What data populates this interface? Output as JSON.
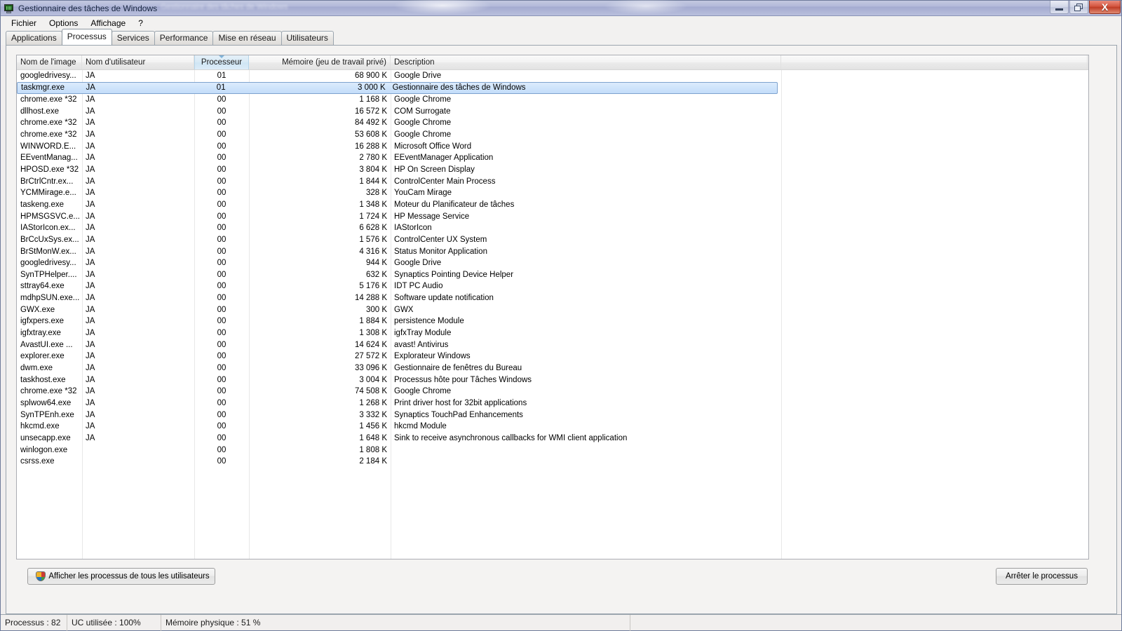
{
  "window": {
    "title": "Gestionnaire des tâches de Windows",
    "title_ghost": "Gestionnaire des tâches de Windows",
    "icon": "task-manager-icon",
    "buttons": {
      "minimize": "minimize-icon",
      "maximize": "restore-icon",
      "close": "X"
    }
  },
  "menu": {
    "items": [
      {
        "label": "Fichier"
      },
      {
        "label": "Options"
      },
      {
        "label": "Affichage"
      },
      {
        "label": "?"
      }
    ]
  },
  "tabs": [
    {
      "label": "Applications",
      "active": false
    },
    {
      "label": "Processus",
      "active": true
    },
    {
      "label": "Services",
      "active": false
    },
    {
      "label": "Performance",
      "active": false
    },
    {
      "label": "Mise en réseau",
      "active": false
    },
    {
      "label": "Utilisateurs",
      "active": false
    }
  ],
  "table": {
    "sort_column": "Processeur",
    "sort_direction": "descending",
    "columns": [
      {
        "key": "name",
        "label": "Nom de l'image",
        "align": "left"
      },
      {
        "key": "user",
        "label": "Nom d'utilisateur",
        "align": "left"
      },
      {
        "key": "cpu",
        "label": "Processeur",
        "align": "center"
      },
      {
        "key": "mem",
        "label": "Mémoire (jeu de travail privé)",
        "align": "right"
      },
      {
        "key": "desc",
        "label": "Description",
        "align": "left"
      }
    ],
    "rows": [
      {
        "name": "googledrivesy...",
        "user": "JA",
        "cpu": "01",
        "mem": "68 900 K",
        "desc": "Google Drive",
        "selected": false
      },
      {
        "name": "taskmgr.exe",
        "user": "JA",
        "cpu": "01",
        "mem": "3 000 K",
        "desc": "Gestionnaire des tâches de Windows",
        "selected": true
      },
      {
        "name": "chrome.exe *32",
        "user": "JA",
        "cpu": "00",
        "mem": "1 168 K",
        "desc": "Google Chrome",
        "selected": false
      },
      {
        "name": "dllhost.exe",
        "user": "JA",
        "cpu": "00",
        "mem": "16 572 K",
        "desc": "COM Surrogate",
        "selected": false
      },
      {
        "name": "chrome.exe *32",
        "user": "JA",
        "cpu": "00",
        "mem": "84 492 K",
        "desc": "Google Chrome",
        "selected": false
      },
      {
        "name": "chrome.exe *32",
        "user": "JA",
        "cpu": "00",
        "mem": "53 608 K",
        "desc": "Google Chrome",
        "selected": false
      },
      {
        "name": "WINWORD.E...",
        "user": "JA",
        "cpu": "00",
        "mem": "16 288 K",
        "desc": "Microsoft Office Word",
        "selected": false
      },
      {
        "name": "EEventManag...",
        "user": "JA",
        "cpu": "00",
        "mem": "2 780 K",
        "desc": "EEventManager Application",
        "selected": false
      },
      {
        "name": "HPOSD.exe *32",
        "user": "JA",
        "cpu": "00",
        "mem": "3 804 K",
        "desc": "HP On Screen Display",
        "selected": false
      },
      {
        "name": "BrCtrlCntr.ex...",
        "user": "JA",
        "cpu": "00",
        "mem": "1 844 K",
        "desc": "ControlCenter Main Process",
        "selected": false
      },
      {
        "name": "YCMMirage.e...",
        "user": "JA",
        "cpu": "00",
        "mem": "328 K",
        "desc": "YouCam Mirage",
        "selected": false
      },
      {
        "name": "taskeng.exe",
        "user": "JA",
        "cpu": "00",
        "mem": "1 348 K",
        "desc": "Moteur du Planificateur de tâches",
        "selected": false
      },
      {
        "name": "HPMSGSVC.e...",
        "user": "JA",
        "cpu": "00",
        "mem": "1 724 K",
        "desc": "HP Message Service",
        "selected": false
      },
      {
        "name": "IAStorIcon.ex...",
        "user": "JA",
        "cpu": "00",
        "mem": "6 628 K",
        "desc": "IAStorIcon",
        "selected": false
      },
      {
        "name": "BrCcUxSys.ex...",
        "user": "JA",
        "cpu": "00",
        "mem": "1 576 K",
        "desc": "ControlCenter UX System",
        "selected": false
      },
      {
        "name": "BrStMonW.ex...",
        "user": "JA",
        "cpu": "00",
        "mem": "4 316 K",
        "desc": "Status Monitor Application",
        "selected": false
      },
      {
        "name": "googledrivesy...",
        "user": "JA",
        "cpu": "00",
        "mem": "944 K",
        "desc": "Google Drive",
        "selected": false
      },
      {
        "name": "SynTPHelper....",
        "user": "JA",
        "cpu": "00",
        "mem": "632 K",
        "desc": "Synaptics Pointing Device Helper",
        "selected": false
      },
      {
        "name": "sttray64.exe",
        "user": "JA",
        "cpu": "00",
        "mem": "5 176 K",
        "desc": "IDT PC Audio",
        "selected": false
      },
      {
        "name": "mdhpSUN.exe...",
        "user": "JA",
        "cpu": "00",
        "mem": "14 288 K",
        "desc": "Software update notification",
        "selected": false
      },
      {
        "name": "GWX.exe",
        "user": "JA",
        "cpu": "00",
        "mem": "300 K",
        "desc": "GWX",
        "selected": false
      },
      {
        "name": "igfxpers.exe",
        "user": "JA",
        "cpu": "00",
        "mem": "1 884 K",
        "desc": "persistence Module",
        "selected": false
      },
      {
        "name": "igfxtray.exe",
        "user": "JA",
        "cpu": "00",
        "mem": "1 308 K",
        "desc": "igfxTray Module",
        "selected": false
      },
      {
        "name": "AvastUI.exe ...",
        "user": "JA",
        "cpu": "00",
        "mem": "14 624 K",
        "desc": "avast! Antivirus",
        "selected": false
      },
      {
        "name": "explorer.exe",
        "user": "JA",
        "cpu": "00",
        "mem": "27 572 K",
        "desc": "Explorateur Windows",
        "selected": false
      },
      {
        "name": "dwm.exe",
        "user": "JA",
        "cpu": "00",
        "mem": "33 096 K",
        "desc": "Gestionnaire de fenêtres du Bureau",
        "selected": false
      },
      {
        "name": "taskhost.exe",
        "user": "JA",
        "cpu": "00",
        "mem": "3 004 K",
        "desc": "Processus hôte pour Tâches Windows",
        "selected": false
      },
      {
        "name": "chrome.exe *32",
        "user": "JA",
        "cpu": "00",
        "mem": "74 508 K",
        "desc": "Google Chrome",
        "selected": false
      },
      {
        "name": "splwow64.exe",
        "user": "JA",
        "cpu": "00",
        "mem": "1 268 K",
        "desc": "Print driver host for 32bit applications",
        "selected": false
      },
      {
        "name": "SynTPEnh.exe",
        "user": "JA",
        "cpu": "00",
        "mem": "3 332 K",
        "desc": "Synaptics TouchPad Enhancements",
        "selected": false
      },
      {
        "name": "hkcmd.exe",
        "user": "JA",
        "cpu": "00",
        "mem": "1 456 K",
        "desc": "hkcmd Module",
        "selected": false
      },
      {
        "name": "unsecapp.exe",
        "user": "JA",
        "cpu": "00",
        "mem": "1 648 K",
        "desc": "Sink to receive asynchronous callbacks for WMI client application",
        "selected": false
      },
      {
        "name": "winlogon.exe",
        "user": "",
        "cpu": "00",
        "mem": "1 808 K",
        "desc": "",
        "selected": false
      },
      {
        "name": "csrss.exe",
        "user": "",
        "cpu": "00",
        "mem": "2 184 K",
        "desc": "",
        "selected": false
      }
    ]
  },
  "buttons": {
    "show_all_users": "Afficher les processus de tous les utilisateurs",
    "show_all_users_icon": "uac-shield-icon",
    "end_process": "Arrêter le processus"
  },
  "statusbar": {
    "processes": "Processus : 82",
    "cpu_usage": "UC utilisée : 100%",
    "physical_memory": "Mémoire physique : 51 %"
  },
  "colors": {
    "selection": "#cfe4fb",
    "selection_border": "#7da2ce",
    "sorted_header": "#d8eaf6",
    "title_bar": "#b3bada",
    "close_button": "#c9422b"
  }
}
